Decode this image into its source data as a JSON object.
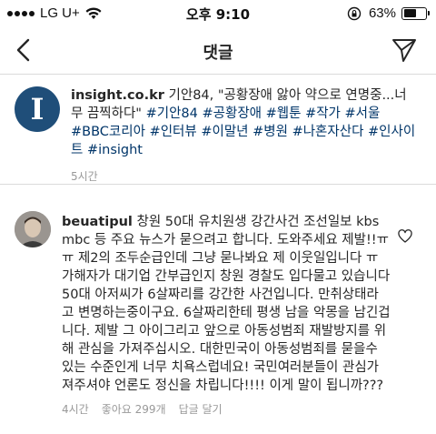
{
  "status_bar": {
    "carrier": "LG U+",
    "time": "오후 9:10",
    "battery_percent": "63%",
    "battery_level": 0.63
  },
  "nav": {
    "title": "댓글"
  },
  "caption": {
    "username": "insight.co.kr",
    "text": " 기안84, \"공황장애 앓아 약으로 연명중...너무 끔찍하다\" ",
    "hashtags": [
      "#기안84",
      "#공황장애",
      "#웹툰",
      "#작가",
      "#서울",
      "#BBC코리아",
      "#인터뷰",
      "#이말년",
      "#병원",
      "#나혼자산다",
      "#인사이트",
      "#insight"
    ],
    "time": "5시간",
    "avatar_letter": "I"
  },
  "comment": {
    "username": "beuatipul",
    "text": " 창원 50대 유치원생 강간사건 조선일보 kbs mbc 등 주요 뉴스가 묻으려고 합니다. 도와주세요 제발!!ㅠㅠ 제2의 조두순급인데 그냥 묻나봐요 제 이웃일입니다 ㅠ 가해자가 대기업 간부급인지 창원 경찰도 입다물고 있습니다 50대 아저씨가 6살짜리를 강간한 사건입니다. 만취상태라고 변명하는중이구요. 6살짜리한테 평생 남을 악몽을 남긴겁니다. 제발 그 아이그리고 앞으로 아동성범죄 재발방지를 위해 관심을 가져주십시오. 대한민국이 아동성범죄를 묻을수 있는 수준인게 너무 치욕스럽네요! 국민여러분들이 관심가져주셔야 언론도 정신을 차립니다!!!! 이게 말이 됩니까???",
    "time": "4시간",
    "likes": "좋아요 299개",
    "reply": "답글 달기"
  }
}
